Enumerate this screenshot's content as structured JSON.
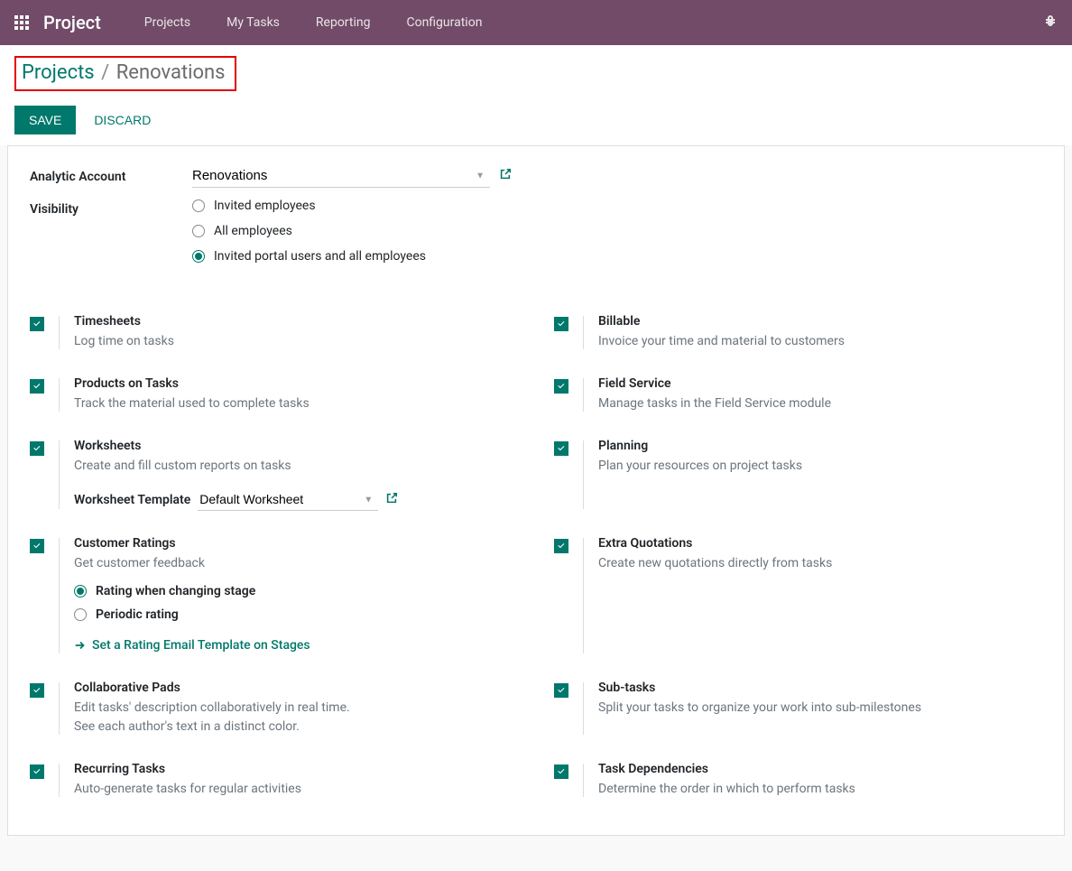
{
  "navbar": {
    "app_name": "Project",
    "links": [
      "Projects",
      "My Tasks",
      "Reporting",
      "Configuration"
    ]
  },
  "breadcrumb": {
    "root": "Projects",
    "current": "Renovations"
  },
  "actions": {
    "save": "SAVE",
    "discard": "DISCARD"
  },
  "form": {
    "analytic_account_label": "Analytic Account",
    "analytic_account_value": "Renovations",
    "visibility_label": "Visibility",
    "visibility_options": [
      "Invited employees",
      "All employees",
      "Invited portal users and all employees"
    ],
    "visibility_selected": 2
  },
  "features_left": [
    {
      "title": "Timesheets",
      "desc": "Log time on tasks",
      "checked": true
    },
    {
      "title": "Products on Tasks",
      "desc": "Track the material used to complete tasks",
      "checked": true
    },
    {
      "title": "Worksheets",
      "desc": "Create and fill custom reports on tasks",
      "checked": true,
      "worksheet_template_label": "Worksheet Template",
      "worksheet_template_value": "Default Worksheet"
    },
    {
      "title": "Customer Ratings",
      "desc": "Get customer feedback",
      "checked": true,
      "rating_options": [
        "Rating when changing stage",
        "Periodic rating"
      ],
      "rating_selected": 0,
      "rating_link": "Set a Rating Email Template on Stages"
    },
    {
      "title": "Collaborative Pads",
      "desc": "Edit tasks' description collaboratively in real time.\nSee each author's text in a distinct color.",
      "checked": true
    },
    {
      "title": "Recurring Tasks",
      "desc": "Auto-generate tasks for regular activities",
      "checked": true
    }
  ],
  "features_right": [
    {
      "title": "Billable",
      "desc": "Invoice your time and material to customers",
      "checked": true
    },
    {
      "title": "Field Service",
      "desc": "Manage tasks in the Field Service module",
      "checked": true
    },
    {
      "title": "Planning",
      "desc": "Plan your resources on project tasks",
      "checked": true
    },
    {
      "title": "Extra Quotations",
      "desc": "Create new quotations directly from tasks",
      "checked": true
    },
    {
      "title": "Sub-tasks",
      "desc": "Split your tasks to organize your work into sub-milestones",
      "checked": true
    },
    {
      "title": "Task Dependencies",
      "desc": "Determine the order in which to perform tasks",
      "checked": true
    }
  ]
}
